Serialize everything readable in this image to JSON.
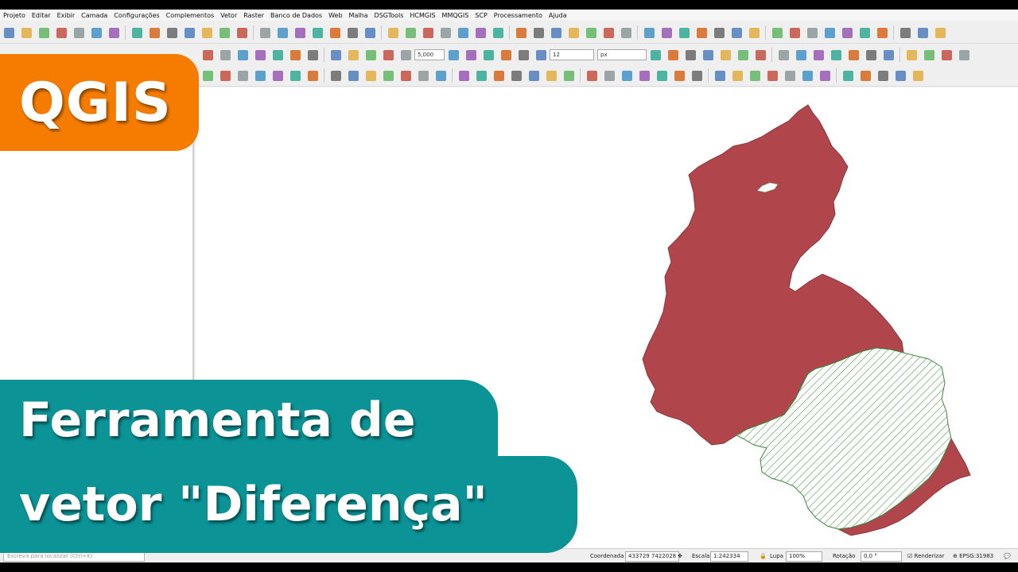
{
  "menu": [
    "Projeto",
    "Editar",
    "Exibir",
    "Camada",
    "Configurações",
    "Complementos",
    "Vetor",
    "Raster",
    "Banco de Dados",
    "Web",
    "Malha",
    "DSGTools",
    "HCMGIS",
    "MMQGIS",
    "SCP",
    "Processamento",
    "Ajuda"
  ],
  "toolbar": {
    "scale_value": "5,000",
    "font_size_value": "12",
    "unit_value": "px"
  },
  "status": {
    "search_placeholder": "Escreva para localizar (Ctrl+K)",
    "coordinate_label": "Coordenada",
    "coordinate_value": "433729 7422028",
    "scale_label": "Escala",
    "scale_value": "1:242334",
    "magnifier_label": "Lupa",
    "magnifier_value": "100%",
    "rotation_label": "Rotação",
    "rotation_value": "0,0 °",
    "render_label": "Renderizar",
    "crs_label": "EPSG:31983"
  },
  "overlay": {
    "app_name": "QGIS",
    "title_line1": "Ferramenta de",
    "title_line2": "vetor \"Diferença\""
  },
  "colors": {
    "polygon_fill": "#b0454c",
    "hatch": "#4a9a4a",
    "brand_orange": "#f57c00",
    "title_teal": "#0b9396"
  }
}
